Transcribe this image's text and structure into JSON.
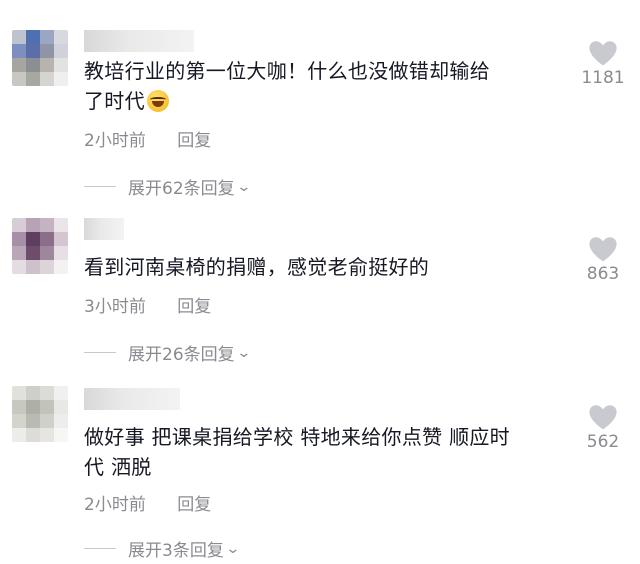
{
  "comments": [
    {
      "text": "教培行业的第一位大咖！什么也没做错却输给了时代",
      "line1": "教培行业的第一位大咖！什么也没做错却输给",
      "line2": "了时代",
      "emoji": "laughing-tears-emoji",
      "time": "2小时前",
      "reply": "回复",
      "expand": "展开62条回复",
      "likes": "1181"
    },
    {
      "text": "看到河南桌椅的捐赠，感觉老俞挺好的",
      "line1": "看到河南桌椅的捐赠，感觉老俞挺好的",
      "time": "3小时前",
      "reply": "回复",
      "expand": "展开26条回复",
      "likes": "863"
    },
    {
      "text": "做好事 把课桌捐给学校 特地来给你点赞 顺应时代 洒脱",
      "line1": "做好事 把课桌捐给学校 特地来给你点赞 顺应时",
      "line2": "代 洒脱",
      "time": "2小时前",
      "reply": "回复",
      "expand": "展开3条回复",
      "likes": "562"
    }
  ],
  "icons": {
    "like": "heart-icon",
    "expand": "chevron-down-icon"
  },
  "colors": {
    "text": "#161823",
    "secondary": "#8a8b91",
    "heart": "#c9cacf"
  }
}
